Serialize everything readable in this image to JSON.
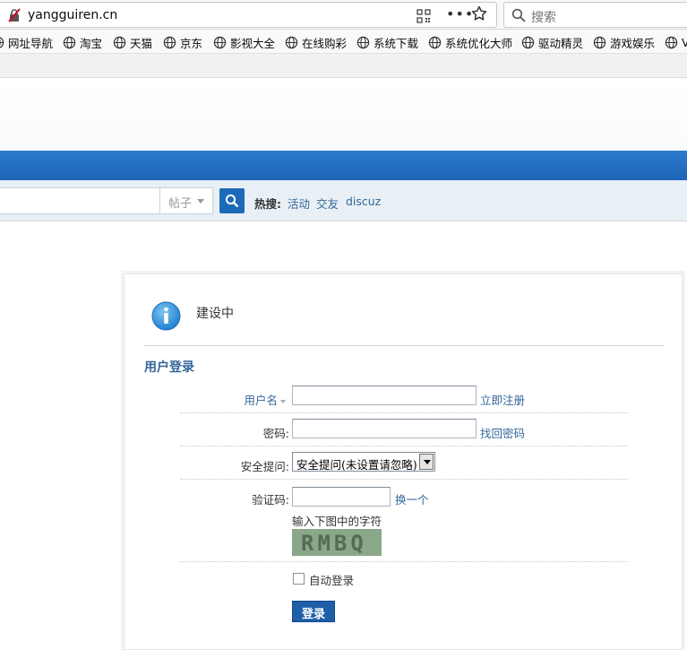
{
  "browser": {
    "url": "yangguiren.cn",
    "search_placeholder": "搜索",
    "more_glyph": "•••",
    "bookmarks": [
      "网址导航",
      "淘宝",
      "天猫",
      "京东",
      "影视大全",
      "在线购彩",
      "系统下载",
      "系统优化大师",
      "驱动精灵",
      "游戏娱乐",
      "V"
    ]
  },
  "search_bar": {
    "type_select": "帖子",
    "hot_label": "热搜:",
    "hot_links": [
      "活动",
      "交友",
      "discuz"
    ]
  },
  "notice": {
    "message": "建设中"
  },
  "login": {
    "title": "用户登录",
    "username_label": "用户名",
    "register_link": "立即注册",
    "password_label": "密码:",
    "recover_link": "找回密码",
    "question_label": "安全提问:",
    "question_value": "安全提问(未设置请忽略)",
    "captcha_label": "验证码:",
    "captcha_refresh": "换一个",
    "captcha_hint": "输入下图中的字符",
    "captcha_text": "RMBQ",
    "remember_label": "自动登录",
    "submit_label": "登录"
  },
  "colors": {
    "nav_blue": "#2b7acd",
    "link_blue": "#336699",
    "button_blue": "#1f5fa8"
  }
}
